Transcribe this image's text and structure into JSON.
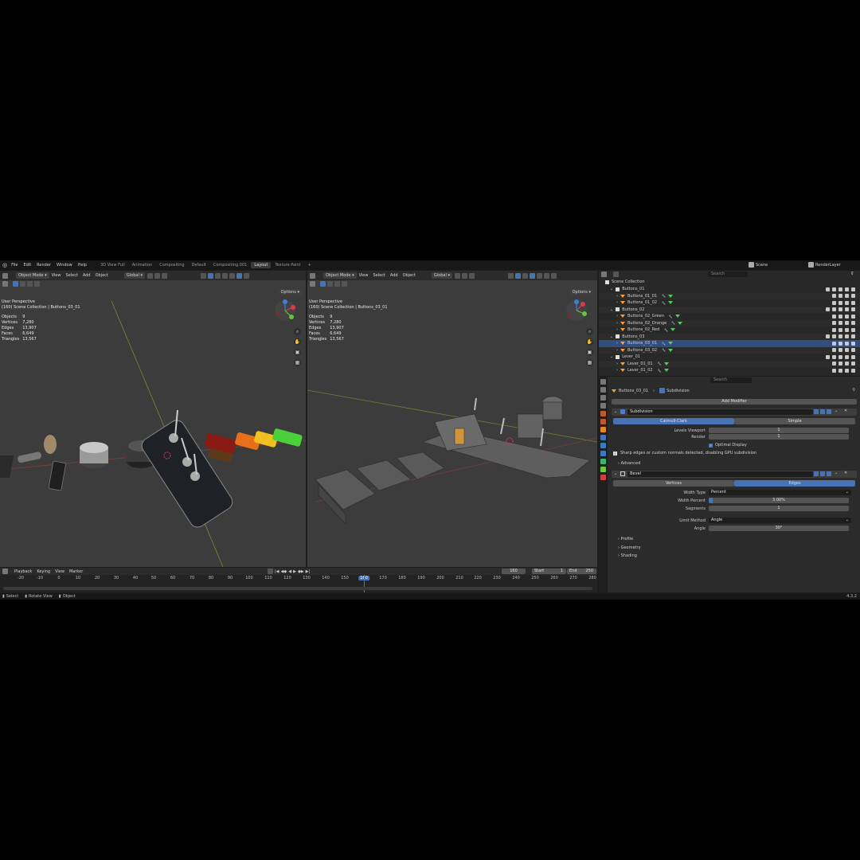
{
  "menu": {
    "items": [
      "File",
      "Edit",
      "Render",
      "Window",
      "Help"
    ]
  },
  "workspaces": {
    "tabs": [
      "3D View Full",
      "Animation",
      "Compositing",
      "Default",
      "Compositing.001",
      "Layout",
      "Texture Paint"
    ],
    "active": "Layout",
    "add": "+"
  },
  "scene": {
    "label": "Scene",
    "render_layer": "RenderLayer"
  },
  "viewport_left": {
    "mode": "Object Mode",
    "menus": [
      "View",
      "Select",
      "Add",
      "Object"
    ],
    "orientation": "Global",
    "options": "Options",
    "perspective": "User Perspective",
    "collection": "(160) Scene Collection | Buttons_03_01",
    "stats": [
      [
        "Objects",
        "9"
      ],
      [
        "Vertices",
        "7,280"
      ],
      [
        "Edges",
        "13,907"
      ],
      [
        "Faces",
        "6,649"
      ],
      [
        "Triangles",
        "13,567"
      ]
    ]
  },
  "viewport_right": {
    "mode": "Object Mode",
    "menus": [
      "View",
      "Select",
      "Add",
      "Object"
    ],
    "orientation": "Global",
    "options": "Options",
    "perspective": "User Perspective",
    "collection": "(160) Scene Collection | Buttons_03_01",
    "stats": [
      [
        "Objects",
        "9"
      ],
      [
        "Vertices",
        "7,280"
      ],
      [
        "Edges",
        "13,907"
      ],
      [
        "Faces",
        "6,649"
      ],
      [
        "Triangles",
        "13,567"
      ]
    ]
  },
  "timeline": {
    "menus": [
      "Playback",
      "Keying",
      "View",
      "Marker"
    ],
    "current_frame": "160",
    "start_label": "Start",
    "start": "1",
    "end_label": "End",
    "end": "250",
    "ticks": [
      "-20",
      "-10",
      "0",
      "10",
      "20",
      "30",
      "40",
      "50",
      "60",
      "70",
      "80",
      "90",
      "100",
      "110",
      "120",
      "130",
      "140",
      "150",
      "160",
      "170",
      "180",
      "190",
      "200",
      "210",
      "220",
      "230",
      "240",
      "250",
      "260",
      "270",
      "280"
    ]
  },
  "statusbar": {
    "select": "Select",
    "rotate": "Rotate View",
    "object": "Object",
    "version": "4.3.2"
  },
  "outliner": {
    "search_placeholder": "Search",
    "root": "Scene Collection",
    "rows": [
      {
        "name": "Buttons_01",
        "kind": "collection",
        "indent": 1
      },
      {
        "name": "Buttons_01_01",
        "kind": "object",
        "indent": 2
      },
      {
        "name": "Buttons_01_02",
        "kind": "object",
        "indent": 2
      },
      {
        "name": "Buttons_02",
        "kind": "collection",
        "indent": 1
      },
      {
        "name": "Buttons_02_Green",
        "kind": "object",
        "indent": 2
      },
      {
        "name": "Buttons_02_Orange",
        "kind": "object",
        "indent": 2
      },
      {
        "name": "Buttons_02_Red",
        "kind": "object",
        "indent": 2
      },
      {
        "name": "Buttons_03",
        "kind": "collection",
        "indent": 1
      },
      {
        "name": "Buttons_03_01",
        "kind": "object",
        "indent": 2,
        "selected": true
      },
      {
        "name": "Buttons_03_02",
        "kind": "object",
        "indent": 2
      },
      {
        "name": "Lever_01",
        "kind": "collection",
        "indent": 1
      },
      {
        "name": "Lever_01_01",
        "kind": "object",
        "indent": 2
      },
      {
        "name": "Lever_01_02",
        "kind": "object",
        "indent": 2
      }
    ]
  },
  "properties": {
    "search_placeholder": "Search",
    "object_name": "Buttons_03_01",
    "context": "Subdivision",
    "add_modifier": "Add Modifier",
    "subdivision": {
      "name": "Subdivision",
      "type_on": "Catmull-Clark",
      "type_off": "Simple",
      "levels_viewport_label": "Levels Viewport",
      "levels_viewport": "1",
      "render_label": "Render",
      "render": "1",
      "optimal_display": "Optimal Display",
      "warning": "Sharp edges or custom normals detected, disabling GPU subdivision",
      "advanced": "Advanced"
    },
    "bevel": {
      "name": "Bevel",
      "tab_off": "Vertices",
      "tab_on": "Edges",
      "width_type_label": "Width Type",
      "width_type": "Percent",
      "width_percent_label": "Width Percent",
      "width_percent": "3.00%",
      "width_percent_value": 3,
      "segments_label": "Segments",
      "segments": "1",
      "limit_method_label": "Limit Method",
      "limit_method": "Angle",
      "angle_label": "Angle",
      "angle": "30°",
      "subpanels": [
        "Profile",
        "Geometry",
        "Shading"
      ]
    }
  },
  "colors": {
    "accent": "#4772b3",
    "object_orange": "#ff9b3a",
    "mesh_green": "#4fce5a",
    "viewport_bg": "#3c3c3c"
  }
}
